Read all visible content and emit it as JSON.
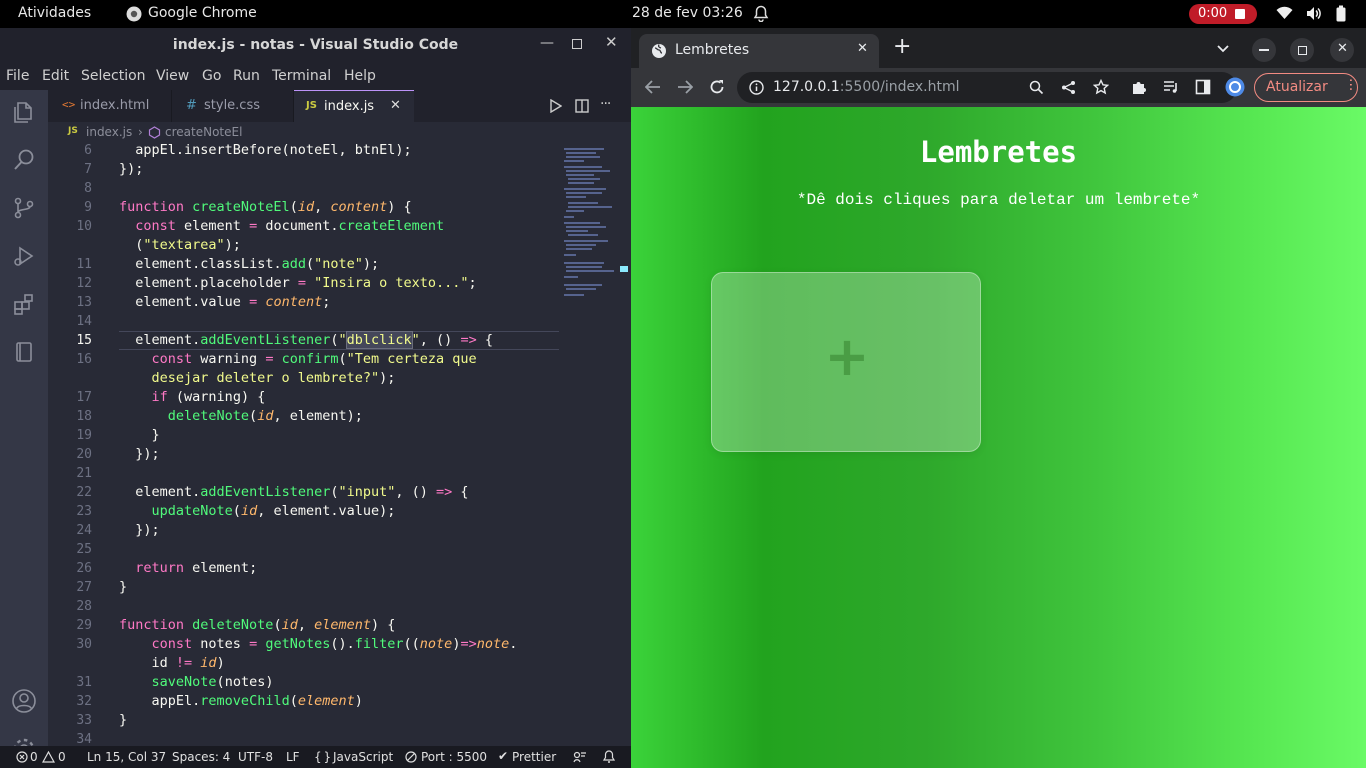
{
  "topbar": {
    "activities": "Atividades",
    "app_name": "Google Chrome",
    "clock": "28 de fev  03:26",
    "recording": "0:00"
  },
  "vscode": {
    "title": "index.js - notas - Visual Studio Code",
    "menu": [
      "File",
      "Edit",
      "Selection",
      "View",
      "Go",
      "Run",
      "Terminal",
      "Help"
    ],
    "tabs": [
      {
        "label": "index.html",
        "icon": "<>"
      },
      {
        "label": "style.css",
        "icon": "#"
      },
      {
        "label": "index.js",
        "icon": "JS"
      }
    ],
    "breadcrumb": {
      "file": "index.js",
      "symbol": "createNoteEl"
    },
    "status": {
      "errors": "0",
      "warnings": "0",
      "position": "Ln 15, Col 37",
      "spaces": "Spaces: 4",
      "encoding": "UTF-8",
      "eol": "LF",
      "language": "JavaScript",
      "port": "Port : 5500",
      "prettier": "Prettier"
    }
  },
  "code_lines": [
    {
      "n": "6",
      "tokens": [
        [
          "pl",
          "  appEl.insertBefore(noteEl, btnEl);"
        ]
      ]
    },
    {
      "n": "7",
      "tokens": [
        [
          "pl",
          "});"
        ]
      ]
    },
    {
      "n": "8",
      "tokens": []
    },
    {
      "n": "9",
      "tokens": [
        [
          "kw",
          "function "
        ],
        [
          "fn",
          "createNoteEl"
        ],
        [
          "pl",
          "("
        ],
        [
          "prm",
          "id"
        ],
        [
          "pl",
          ", "
        ],
        [
          "prm",
          "content"
        ],
        [
          "pl",
          ") {"
        ]
      ]
    },
    {
      "n": "10",
      "tokens": [
        [
          "kw",
          "  const "
        ],
        [
          "ident",
          "element "
        ],
        [
          "kw",
          "= "
        ],
        [
          "ident",
          "document"
        ],
        [
          "pl",
          "."
        ],
        [
          "fn",
          "createElement"
        ]
      ]
    },
    {
      "n": "",
      "tokens": [
        [
          "pl",
          "  ("
        ],
        [
          "str",
          "\"textarea\""
        ],
        [
          "pl",
          ");"
        ]
      ]
    },
    {
      "n": "11",
      "tokens": [
        [
          "ident",
          "  element"
        ],
        [
          "pl",
          "."
        ],
        [
          "ident",
          "classList"
        ],
        [
          "pl",
          "."
        ],
        [
          "fn",
          "add"
        ],
        [
          "pl",
          "("
        ],
        [
          "str",
          "\"note\""
        ],
        [
          "pl",
          ");"
        ]
      ]
    },
    {
      "n": "12",
      "tokens": [
        [
          "ident",
          "  element"
        ],
        [
          "pl",
          "."
        ],
        [
          "ident",
          "placeholder "
        ],
        [
          "kw",
          "= "
        ],
        [
          "str",
          "\"Insira o texto...\""
        ],
        [
          "pl",
          ";"
        ]
      ]
    },
    {
      "n": "13",
      "tokens": [
        [
          "ident",
          "  element"
        ],
        [
          "pl",
          "."
        ],
        [
          "ident",
          "value "
        ],
        [
          "kw",
          "= "
        ],
        [
          "prm",
          "content"
        ],
        [
          "pl",
          ";"
        ]
      ]
    },
    {
      "n": "14",
      "tokens": []
    },
    {
      "n": "15",
      "tokens": [
        [
          "ident",
          "  element"
        ],
        [
          "pl",
          "."
        ],
        [
          "fn",
          "addEventListener"
        ],
        [
          "pl",
          "("
        ],
        [
          "str",
          "\""
        ],
        [
          "sel",
          "dblclick"
        ],
        [
          "str",
          "\""
        ],
        [
          "pl",
          ", () "
        ],
        [
          "kw",
          "=> "
        ],
        [
          "pl",
          "{"
        ]
      ]
    },
    {
      "n": "16",
      "tokens": [
        [
          "kw",
          "    const "
        ],
        [
          "ident",
          "warning "
        ],
        [
          "kw",
          "= "
        ],
        [
          "fn",
          "confirm"
        ],
        [
          "pl",
          "("
        ],
        [
          "str",
          "\"Tem certeza que"
        ]
      ]
    },
    {
      "n": "",
      "tokens": [
        [
          "str",
          "    desejar deleter o lembrete?\""
        ],
        [
          "pl",
          ");"
        ]
      ]
    },
    {
      "n": "17",
      "tokens": [
        [
          "kw",
          "    if "
        ],
        [
          "pl",
          "("
        ],
        [
          "ident",
          "warning"
        ],
        [
          "pl",
          ") {"
        ]
      ]
    },
    {
      "n": "18",
      "tokens": [
        [
          "fn",
          "      deleteNote"
        ],
        [
          "pl",
          "("
        ],
        [
          "prm",
          "id"
        ],
        [
          "pl",
          ", "
        ],
        [
          "ident",
          "element"
        ],
        [
          "pl",
          ");"
        ]
      ]
    },
    {
      "n": "19",
      "tokens": [
        [
          "pl",
          "    }"
        ]
      ]
    },
    {
      "n": "20",
      "tokens": [
        [
          "pl",
          "  });"
        ]
      ]
    },
    {
      "n": "21",
      "tokens": []
    },
    {
      "n": "22",
      "tokens": [
        [
          "ident",
          "  element"
        ],
        [
          "pl",
          "."
        ],
        [
          "fn",
          "addEventListener"
        ],
        [
          "pl",
          "("
        ],
        [
          "str",
          "\"input\""
        ],
        [
          "pl",
          ", () "
        ],
        [
          "kw",
          "=> "
        ],
        [
          "pl",
          "{"
        ]
      ]
    },
    {
      "n": "23",
      "tokens": [
        [
          "fn",
          "    updateNote"
        ],
        [
          "pl",
          "("
        ],
        [
          "prm",
          "id"
        ],
        [
          "pl",
          ", "
        ],
        [
          "ident",
          "element"
        ],
        [
          "pl",
          "."
        ],
        [
          "ident",
          "value"
        ],
        [
          "pl",
          ");"
        ]
      ]
    },
    {
      "n": "24",
      "tokens": [
        [
          "pl",
          "  });"
        ]
      ]
    },
    {
      "n": "25",
      "tokens": []
    },
    {
      "n": "26",
      "tokens": [
        [
          "kw",
          "  return "
        ],
        [
          "ident",
          "element"
        ],
        [
          "pl",
          ";"
        ]
      ]
    },
    {
      "n": "27",
      "tokens": [
        [
          "pl",
          "}"
        ]
      ]
    },
    {
      "n": "28",
      "tokens": []
    },
    {
      "n": "29",
      "tokens": [
        [
          "kw",
          "function "
        ],
        [
          "fn",
          "deleteNote"
        ],
        [
          "pl",
          "("
        ],
        [
          "prm",
          "id"
        ],
        [
          "pl",
          ", "
        ],
        [
          "prm",
          "element"
        ],
        [
          "pl",
          ") {"
        ]
      ]
    },
    {
      "n": "30",
      "tokens": [
        [
          "kw",
          "    const "
        ],
        [
          "ident",
          "notes "
        ],
        [
          "kw",
          "= "
        ],
        [
          "fn",
          "getNotes"
        ],
        [
          "pl",
          "()."
        ],
        [
          "fn",
          "filter"
        ],
        [
          "pl",
          "(("
        ],
        [
          "prm",
          "note"
        ],
        [
          "pl",
          ")"
        ],
        [
          "kw",
          "=>"
        ],
        [
          "prm",
          "note"
        ],
        [
          "pl",
          "."
        ]
      ]
    },
    {
      "n": "",
      "tokens": [
        [
          "ident",
          "    id "
        ],
        [
          "kw",
          "!= "
        ],
        [
          "prm",
          "id"
        ],
        [
          "pl",
          ")"
        ]
      ]
    },
    {
      "n": "31",
      "tokens": [
        [
          "fn",
          "    saveNote"
        ],
        [
          "pl",
          "("
        ],
        [
          "ident",
          "notes"
        ],
        [
          "pl",
          ")"
        ]
      ]
    },
    {
      "n": "32",
      "tokens": [
        [
          "ident",
          "    appEl"
        ],
        [
          "pl",
          "."
        ],
        [
          "fn",
          "removeChild"
        ],
        [
          "pl",
          "("
        ],
        [
          "prm",
          "element"
        ],
        [
          "pl",
          ")"
        ]
      ]
    },
    {
      "n": "33",
      "tokens": [
        [
          "pl",
          "}"
        ]
      ]
    },
    {
      "n": "34",
      "tokens": []
    }
  ],
  "chrome": {
    "tab_title": "Lembretes",
    "url_host": "127.0.0.1",
    "url_rest": ":5500/index.html",
    "update_label": "Atualizar"
  },
  "page": {
    "heading": "Lembretes",
    "subtitle": "*Dê dois cliques para deletar um lembrete*",
    "add_symbol": "+"
  },
  "colors": {
    "accent_green": "#3ddc3a",
    "vscode_bg": "#1e1f29",
    "chrome_bg": "#202124",
    "record_red": "#c01c28"
  }
}
